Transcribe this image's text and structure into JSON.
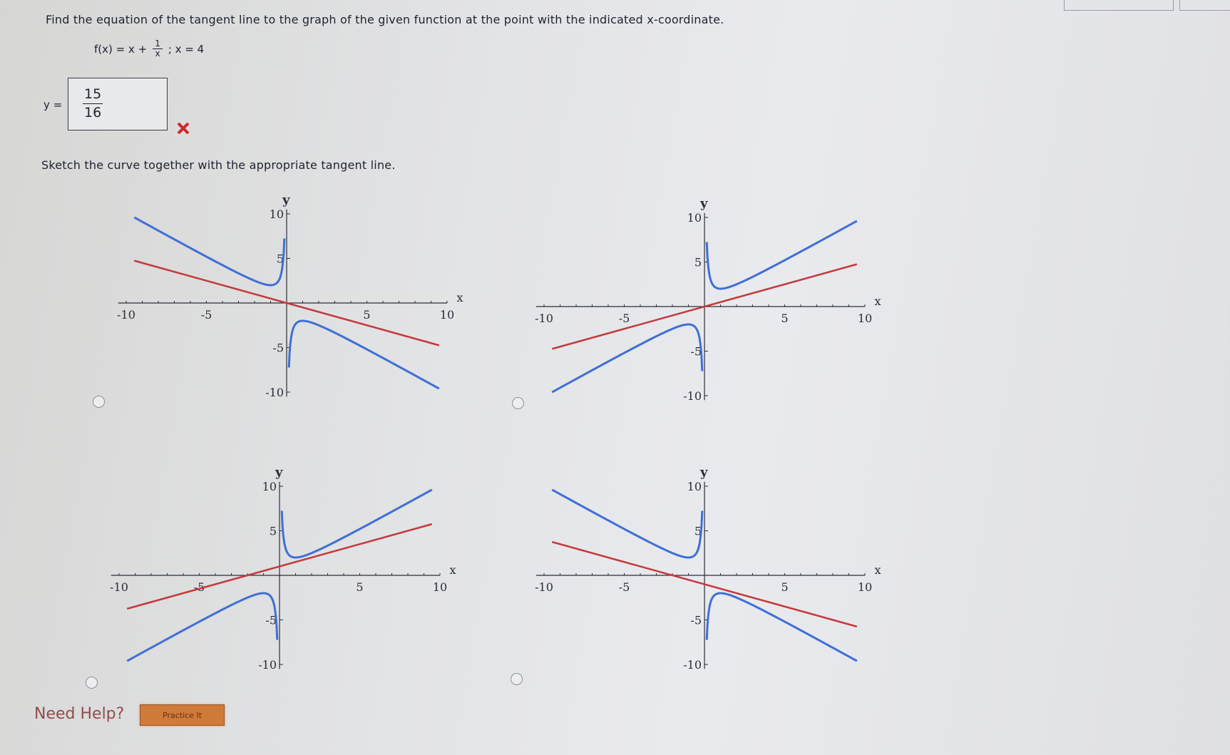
{
  "question": {
    "prompt": "Find the equation of the tangent line to the graph of the given function at the point with the indicated x-coordinate.",
    "function_lhs": "f(x) = x +",
    "frac_num": "1",
    "frac_den": "x",
    "point_text": "; x = 4"
  },
  "answer": {
    "label": "y =",
    "numerator": "15",
    "denominator": "16",
    "status": "incorrect"
  },
  "sketch_prompt": "Sketch the curve together with the appropriate tangent line.",
  "axis": {
    "x_label": "x",
    "y_label": "y",
    "x_ticks": [
      "-10",
      "-5",
      "5",
      "10"
    ],
    "y_ticks": [
      "10",
      "5",
      "-5",
      "-10"
    ]
  },
  "options": [
    {
      "id": "option-a",
      "curve": "-(x + 1/x)",
      "tangent_slope": -0.5,
      "tangent_intercept": 0
    },
    {
      "id": "option-b",
      "curve": "x + 1/x",
      "tangent_slope": 0.5,
      "tangent_intercept": 0
    },
    {
      "id": "option-c",
      "curve": "x + 1/x",
      "tangent_slope": 0.5,
      "tangent_intercept": 1
    },
    {
      "id": "option-d",
      "curve": "-(x + 1/x)",
      "tangent_slope": -0.5,
      "tangent_intercept": -1
    }
  ],
  "colors": {
    "curve": "#3f6fd6",
    "tangent": "#c5383b"
  },
  "help": {
    "label": "Need Help?",
    "button": "Practice It"
  }
}
